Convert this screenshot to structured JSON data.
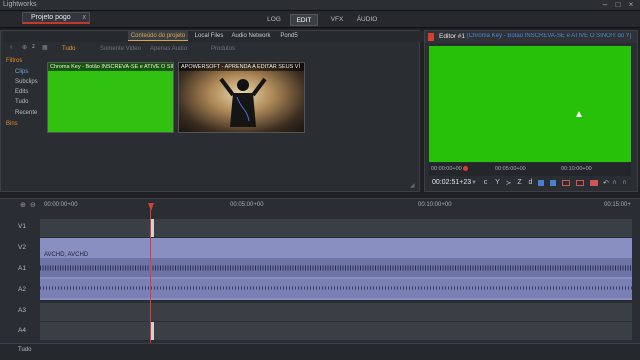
{
  "app": {
    "title": "Lightworks"
  },
  "project": {
    "tab_label": "Projeto pogo",
    "close": "x"
  },
  "nav": {
    "tabs": [
      "LOG",
      "EDIT",
      "VFX",
      "ÁUDIO"
    ],
    "active": "EDIT"
  },
  "window": {
    "minimize": "–",
    "maximize": "□",
    "close": "×"
  },
  "content": {
    "source_tabs": [
      "Conteúdo do projeto",
      "Local Files",
      "Audio Network",
      "Pond5"
    ],
    "active_source": "Conteúdo do projeto",
    "filter_tabs": [
      "Tudo",
      "Somente Video",
      "Apenas Audio",
      "Produtos"
    ],
    "active_filter": "Tudo",
    "sidebar": {
      "filters_label": "Filtros",
      "items": [
        "Clips",
        "Subclips",
        "Edits",
        "Tudo",
        "Recente"
      ],
      "bins_label": "Bins"
    },
    "thumbnails": [
      {
        "caption": "Chroma Key - Botão INSCREVA-SE e ATIVE O SINO"
      },
      {
        "caption": "APOWERSOFT - APRENDA A EDITAR SEUS VÍ"
      }
    ],
    "toolbar_icons": [
      "back-icon",
      "zoom-icon"
    ]
  },
  "viewer": {
    "title": "Editor #1",
    "subtitle": "[Chroma Key - Botão INSCREVA-SE e ATIVE O SINO!!! do Y]",
    "ruler": [
      "00:00:00+00",
      "00:05:00+00",
      "00:10:00+00"
    ],
    "timecode": "00:02:51+23",
    "controls": [
      "c",
      "Y",
      "≻",
      "Z",
      "d"
    ],
    "screen_color": "#27c10a"
  },
  "timeline": {
    "ruler": [
      "00:00:00+00",
      "00:05:00+00",
      "00:10:00+00",
      "00:15:00+"
    ],
    "tracks": [
      {
        "name": "V1"
      },
      {
        "name": "V2"
      },
      {
        "name": "A1"
      },
      {
        "name": "A2"
      },
      {
        "name": "A3"
      },
      {
        "name": "A4"
      }
    ],
    "audio_clip_label": "AVCHD, AVCHD",
    "footer_label": "Tudo",
    "playhead_color": "#d6402e",
    "audio_color": "#8a8fc2"
  }
}
